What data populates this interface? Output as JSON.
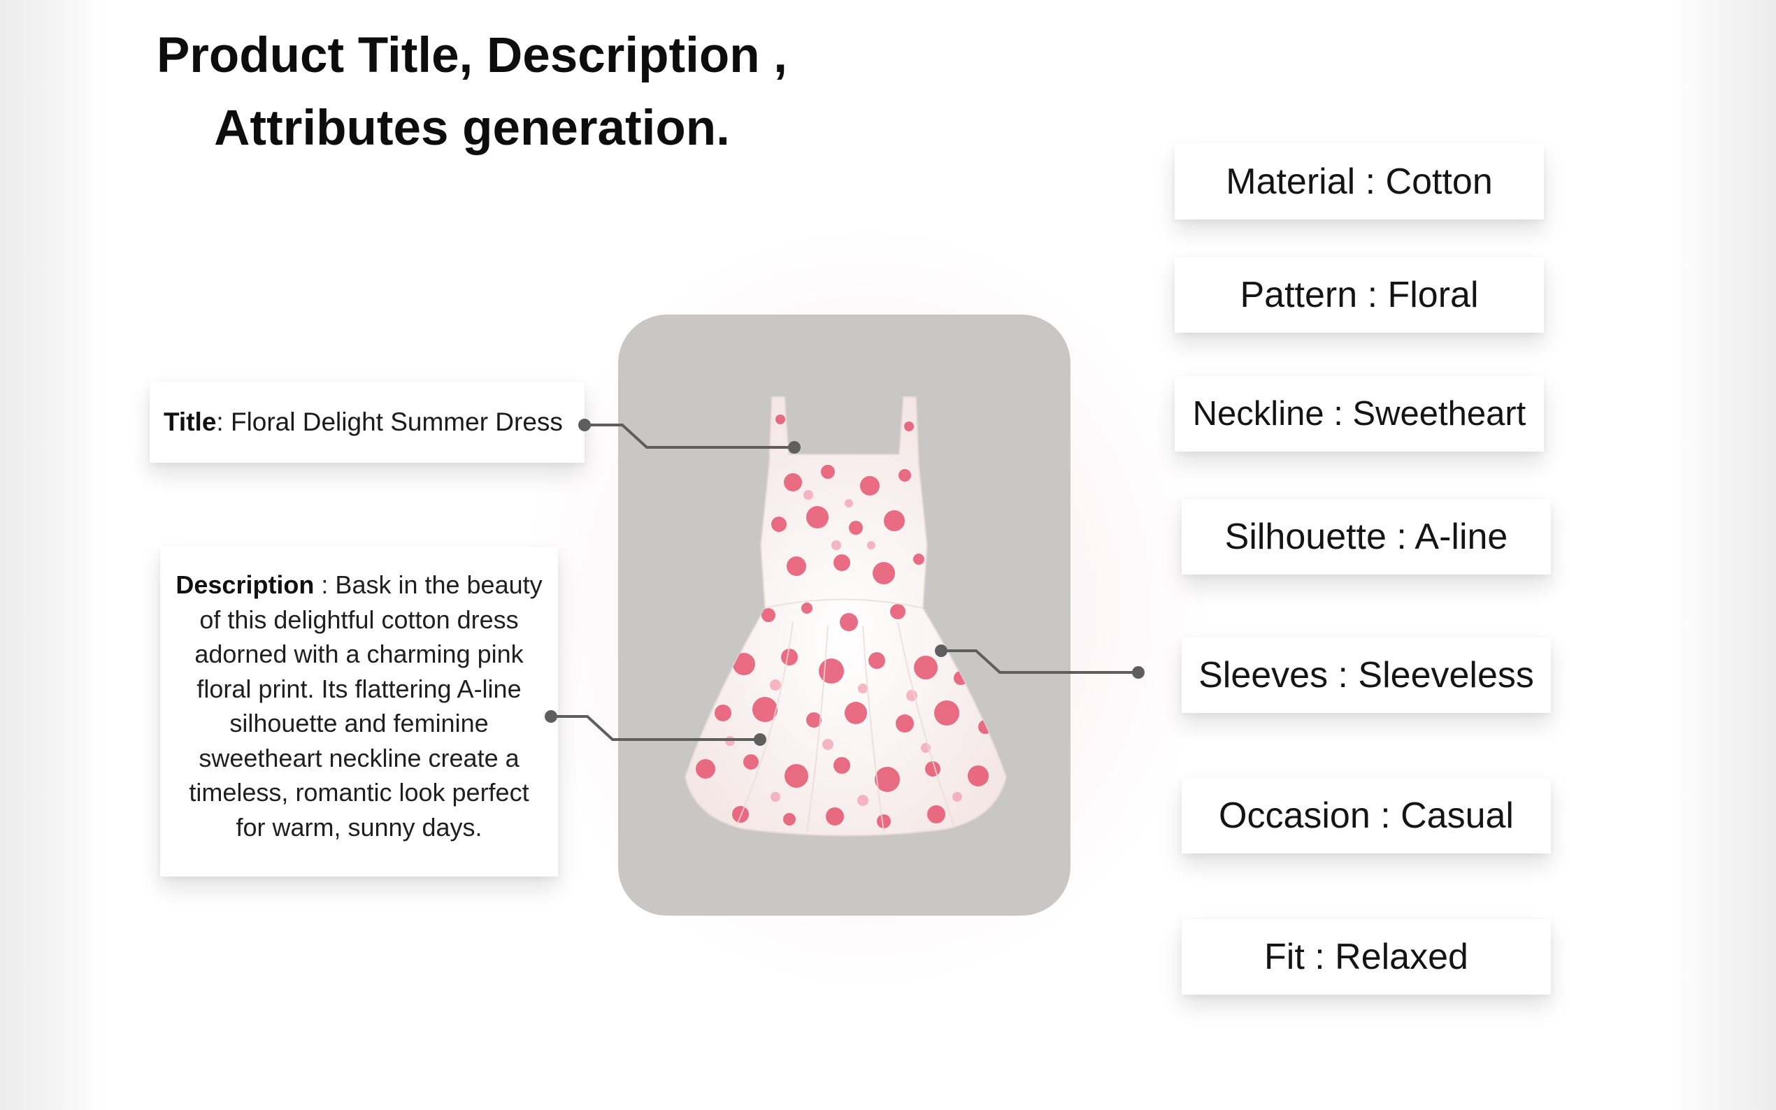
{
  "heading": {
    "line1": "Product Title, Description ,",
    "line2": "Attributes generation."
  },
  "title_card": {
    "label": "Title",
    "value": ": Floral Delight Summer Dress"
  },
  "description_card": {
    "label": "Description",
    "value": " : Bask in the beauty of this delightful cotton dress adorned with a charming pink floral print. Its flattering A-line silhouette and feminine sweetheart neckline create a timeless, romantic look perfect for warm, sunny days."
  },
  "attributes": {
    "material": "Material : Cotton",
    "pattern": "Pattern : Floral",
    "neckline": "Neckline : Sweetheart",
    "silhouette": "Silhouette : A-line",
    "sleeves": "Sleeves : Sleeveless",
    "occasion": "Occasion : Casual",
    "fit": "Fit : Relaxed"
  },
  "colors": {
    "panel_background": "#c8c7c6",
    "dress_base": "#fbf5f3",
    "floral_accent": "#e5546f",
    "connector": "#5e5e5e"
  }
}
